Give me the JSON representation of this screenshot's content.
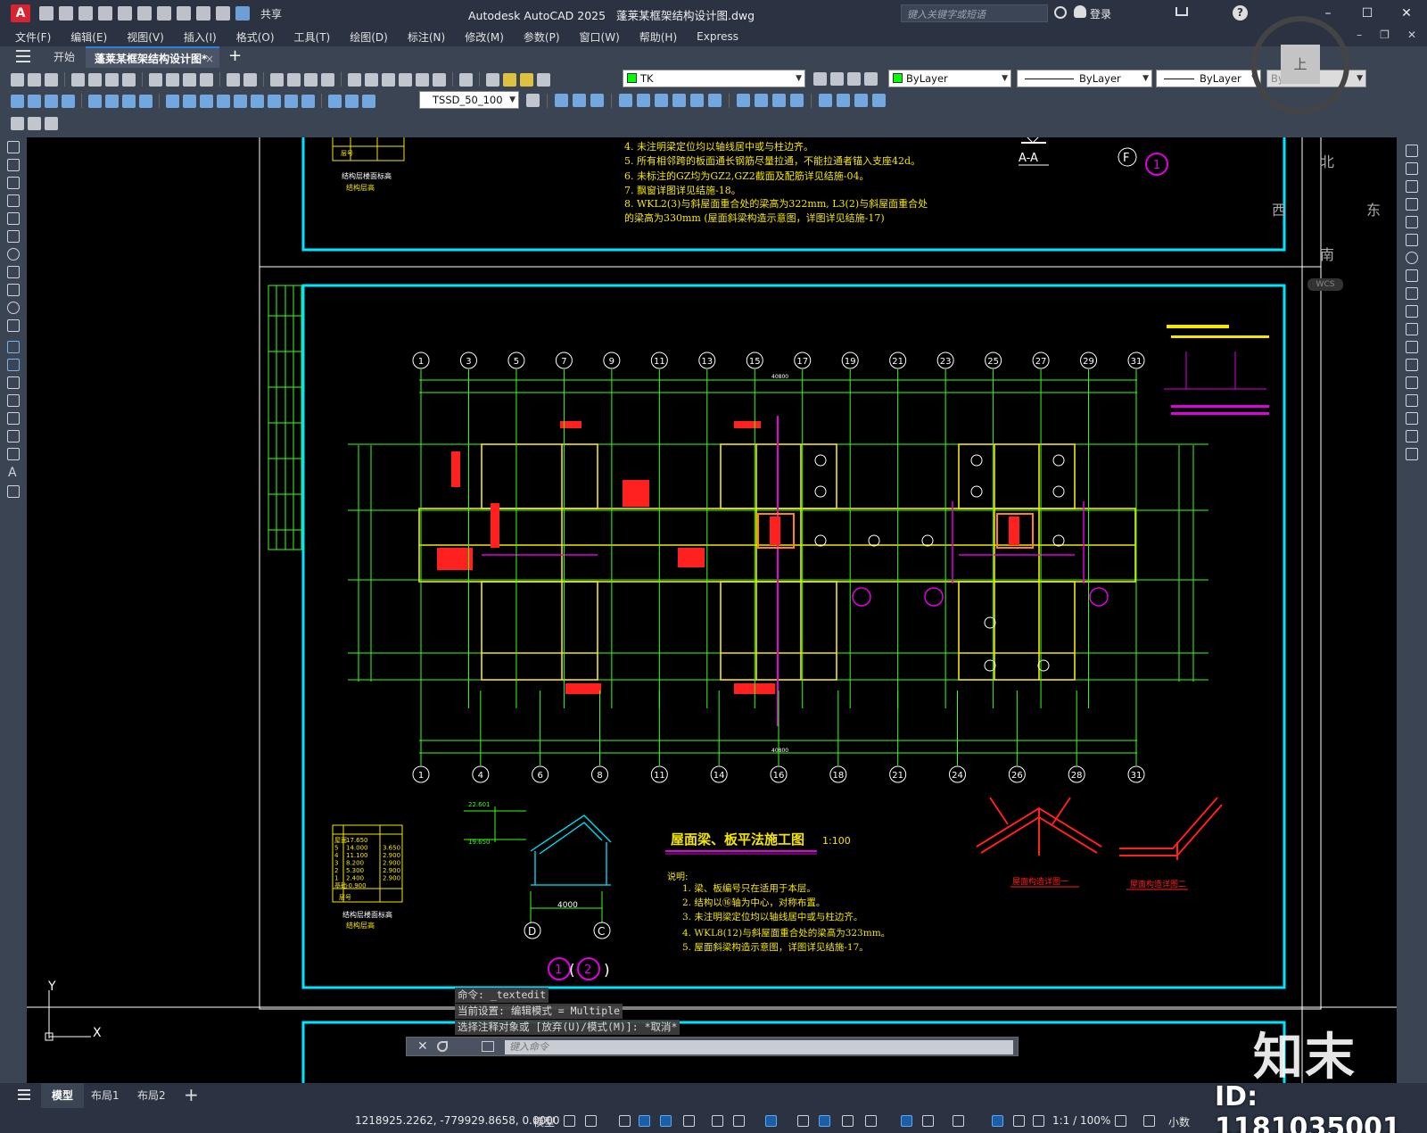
{
  "window": {
    "app_name": "Autodesk AutoCAD 2025",
    "file_name": "蓬莱某框架结构设计图.dwg",
    "share_label": "共享",
    "search_placeholder": "键入关键字或短语",
    "login_label": "登录",
    "logo_letter": "A"
  },
  "menu": {
    "items": [
      "文件(F)",
      "编辑(E)",
      "视图(V)",
      "插入(I)",
      "格式(O)",
      "工具(T)",
      "绘图(D)",
      "标注(N)",
      "修改(M)",
      "参数(P)",
      "窗口(W)",
      "帮助(H)",
      "Express"
    ]
  },
  "tabs": {
    "start": "开始",
    "active": "蓬莱某框架结构设计图*",
    "close": "×",
    "add": "+"
  },
  "toolbar": {
    "layer_value": "TK",
    "color_value": "ByLayer",
    "linetype_value": "ByLayer",
    "lineweight_value": "ByLayer",
    "plotstyle_value": "ByColor",
    "dimstyle_value": "TSSD_50_100"
  },
  "viewcube": {
    "north": "北",
    "south": "南",
    "west": "西",
    "east": "东",
    "top": "上",
    "wcs": "WCS"
  },
  "drawing": {
    "upper_notes": [
      "4. 未注明梁定位均以轴线居中或与柱边齐。",
      "5. 所有相邻跨的板面通长钢筋尽量拉通，不能拉通者锚入支座42d。",
      "6. 未标注的GZ均为GZ2,GZ2截面及配筋详见结施-04。",
      "7. 飘窗详图详见结施-18。",
      "8. WKL2(3)与斜屋面重合处的梁高为322mm, L3(2)与斜屋面重合处",
      "的梁高为330mm (屋面斜梁构造示意图，详图详见结施-17)"
    ],
    "section_label": "A-A",
    "axis_f": "F",
    "axis_1_circle": "1",
    "upper_table_caption_1": "结构层楼面标高",
    "upper_table_caption_2": "结构层高",
    "upper_table_footer": "层号",
    "top_axes": [
      "1",
      "3",
      "5",
      "7",
      "9",
      "11",
      "13",
      "15",
      "17",
      "19",
      "21",
      "23",
      "25",
      "27",
      "29",
      "31"
    ],
    "bottom_axes": [
      "1",
      "4",
      "6",
      "8",
      "11",
      "14",
      "16",
      "18",
      "21",
      "24",
      "26",
      "28",
      "31"
    ],
    "overall_dim": "40800",
    "plan_title": "屋面梁、板平法施工图",
    "plan_scale": "1:100",
    "notes_heading": "说明:",
    "notes": [
      "1. 梁、板编号只在适用于本层。",
      "2. 结构以⑯轴为中心，对称布置。",
      "3. 未注明梁定位均以轴线居中或与柱边齐。",
      "4. WKL8(12)与斜屋面重合处的梁高为323mm。",
      "5. 屋面斜梁构造示意图，详图详见结施-17。"
    ],
    "lower_table_caption_1": "结构层楼面标高",
    "lower_table_caption_2": "结构层高",
    "lower_table_footer": "层号",
    "lower_table_rows": [
      [
        "屋面",
        "17.650",
        ""
      ],
      [
        "5",
        "14.000",
        "3.650"
      ],
      [
        "4",
        "11.100",
        "2.900"
      ],
      [
        "3",
        "8.200",
        "2.900"
      ],
      [
        "2",
        "5.300",
        "2.900"
      ],
      [
        "1",
        "2.400",
        "2.900"
      ],
      [
        "基础",
        "-0.900",
        ""
      ]
    ],
    "section_dim": "4000",
    "section_axis_left": "D",
    "section_axis_right": "C",
    "section_elev_top": "22.601",
    "section_elev_mid": "19.650",
    "detail_1_title": "屋面构造详图一",
    "detail_2_title": "屋面构造详图二",
    "detail_circle_1": "1",
    "detail_circle_2": "2"
  },
  "command": {
    "history": [
      "命令: _textedit",
      "当前设置: 编辑模式 = Multiple",
      "选择注释对象或 [放弃(U)/模式(M)]: *取消*"
    ],
    "input_placeholder": "键入命令"
  },
  "layout_tabs": {
    "model": "模型",
    "layout1": "布局1",
    "layout2": "布局2",
    "add": "+"
  },
  "status": {
    "coords": "1218925.2262, -779929.8658, 0.0000",
    "model": "模型",
    "scale": "1:1 / 100%",
    "units": "小数"
  },
  "watermark": {
    "logo": "知末",
    "id": "ID: 1181035001"
  },
  "colors": {
    "frame_cyan": "#00e5ff",
    "axis_green": "#39ff14",
    "beam_yellow": "#f5e600",
    "text_red": "#ff2020",
    "magenta": "#e000e0"
  }
}
